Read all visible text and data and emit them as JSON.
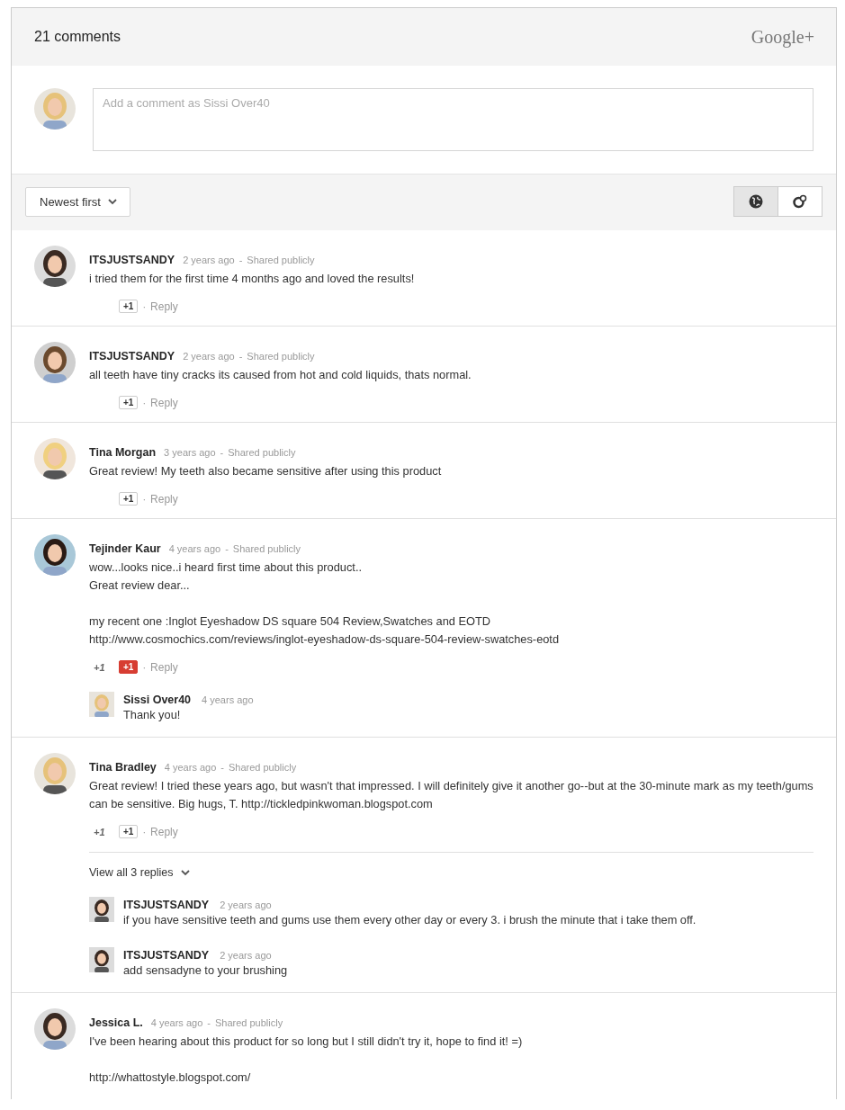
{
  "header": {
    "title": "21 comments",
    "logo": "Google+"
  },
  "composer": {
    "placeholder": "Add a comment as Sissi Over40"
  },
  "sort": {
    "label": "Newest first"
  },
  "view_toggle": [
    {
      "kind": "globe",
      "selected": true
    },
    {
      "kind": "circles",
      "selected": false
    }
  ],
  "comments": [
    {
      "author": "ITSJUSTSANDY",
      "time": "2 years ago",
      "separator": "-",
      "visibility": "Shared publicly",
      "paragraphs": [
        "i tried them for the first time 4 months ago and loved the results!"
      ],
      "plus_button": "+1",
      "plused": false,
      "action_separator": "·",
      "reply": "Reply"
    },
    {
      "author": "ITSJUSTSANDY",
      "time": "2 years ago",
      "separator": "-",
      "visibility": "Shared publicly",
      "paragraphs": [
        "all teeth have tiny cracks its caused from hot and cold liquids, thats normal."
      ],
      "plus_button": "+1",
      "plused": false,
      "action_separator": "·",
      "reply": "Reply"
    },
    {
      "author": "Tina Morgan",
      "time": "3 years ago",
      "separator": "-",
      "visibility": "Shared publicly",
      "paragraphs": [
        "Great review! My teeth also became sensitive after using this product"
      ],
      "plus_button": "+1",
      "plused": false,
      "action_separator": "·",
      "reply": "Reply"
    },
    {
      "author": "Tejinder Kaur",
      "time": "4 years ago",
      "separator": "-",
      "visibility": "Shared publicly",
      "paragraphs": [
        "wow...looks nice..i heard first time about this product..\nGreat review dear...",
        "my recent one :Inglot Eyeshadow DS square 504 Review,Swatches and EOTD\nhttp://www.cosmochics.com/reviews/inglot-eyeshadow-ds-square-504-review-swatches-eotd"
      ],
      "plus_count": "+1",
      "plus_button": "+1",
      "plused": true,
      "action_separator": "·",
      "reply": "Reply",
      "replies": [
        {
          "author": "Sissi Over40",
          "time": "4 years ago",
          "text": "Thank you!"
        }
      ]
    },
    {
      "author": "Tina Bradley",
      "time": "4 years ago",
      "separator": "-",
      "visibility": "Shared publicly",
      "paragraphs": [
        "Great review!  I tried these years ago, but wasn't that impressed.  I will definitely give it another go--but at the 30-minute mark as my teeth/gums can be sensitive.  Big hugs, T. http://tickledpinkwoman.blogspot.com"
      ],
      "plus_count": "+1",
      "plus_button": "+1",
      "plused": false,
      "action_separator": "·",
      "reply": "Reply",
      "view_all": "View all 3 replies",
      "replies": [
        {
          "author": "ITSJUSTSANDY",
          "time": "2 years ago",
          "text": "if you have sensitive teeth and gums use them every other day or every 3. i brush the minute that i take them off."
        },
        {
          "author": "ITSJUSTSANDY",
          "time": "2 years ago",
          "text": "add sensadyne to your brushing"
        }
      ]
    },
    {
      "author": "Jessica L.",
      "time": "4 years ago",
      "separator": "-",
      "visibility": "Shared publicly",
      "paragraphs": [
        "I've been hearing about this product for so long but I still didn't try it, hope to find it! =)",
        "http://whattostyle.blogspot.com/"
      ]
    }
  ]
}
